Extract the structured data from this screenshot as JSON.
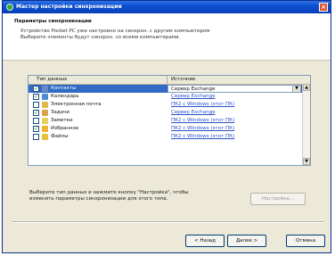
{
  "window": {
    "title": "Мастер настройки синхронизации"
  },
  "header": {
    "title": "Параметры синхронизации",
    "description_line1": "Устройство Pocket PC уже настроено на синхрон. с другим компьютером",
    "description_line2": "Выберите элементы будут синхрон. со всеми компьютерами."
  },
  "list": {
    "col_type": "Тип данных",
    "col_source": "Источник",
    "rows": [
      {
        "checked": true,
        "name": "Контакты",
        "source": "Сервер Exchange",
        "icon_color": "#6a88c8"
      },
      {
        "checked": true,
        "name": "Календарь",
        "source": "Сервер Exchange",
        "icon_color": "#4c8bd6"
      },
      {
        "checked": false,
        "name": "Электронная почта",
        "source": "ПК2 с Windows (этот ПК)",
        "icon_color": "#e0b84a"
      },
      {
        "checked": true,
        "name": "Задачи",
        "source": "Сервер Exchange",
        "icon_color": "#d9a24c"
      },
      {
        "checked": false,
        "name": "Заметки",
        "source": "ПК2 с Windows (этот ПК)",
        "icon_color": "#e8d060"
      },
      {
        "checked": true,
        "name": "Избранное",
        "source": "ПК2 с Windows (этот ПК)",
        "icon_color": "#f0b030"
      },
      {
        "checked": false,
        "name": "Файлы",
        "source": "ПК2 с Windows (этот ПК)",
        "icon_color": "#e8c040"
      }
    ]
  },
  "footer": {
    "hint_line1": "Выберите тип данных и нажмите кнопку \"Настройка\", чтобы",
    "hint_line2": "изменить параметры синхронизации для этого типа."
  },
  "buttons": {
    "settings": "Настройка...",
    "back": "< Назад",
    "next": "Далее >",
    "cancel": "Отмена"
  }
}
